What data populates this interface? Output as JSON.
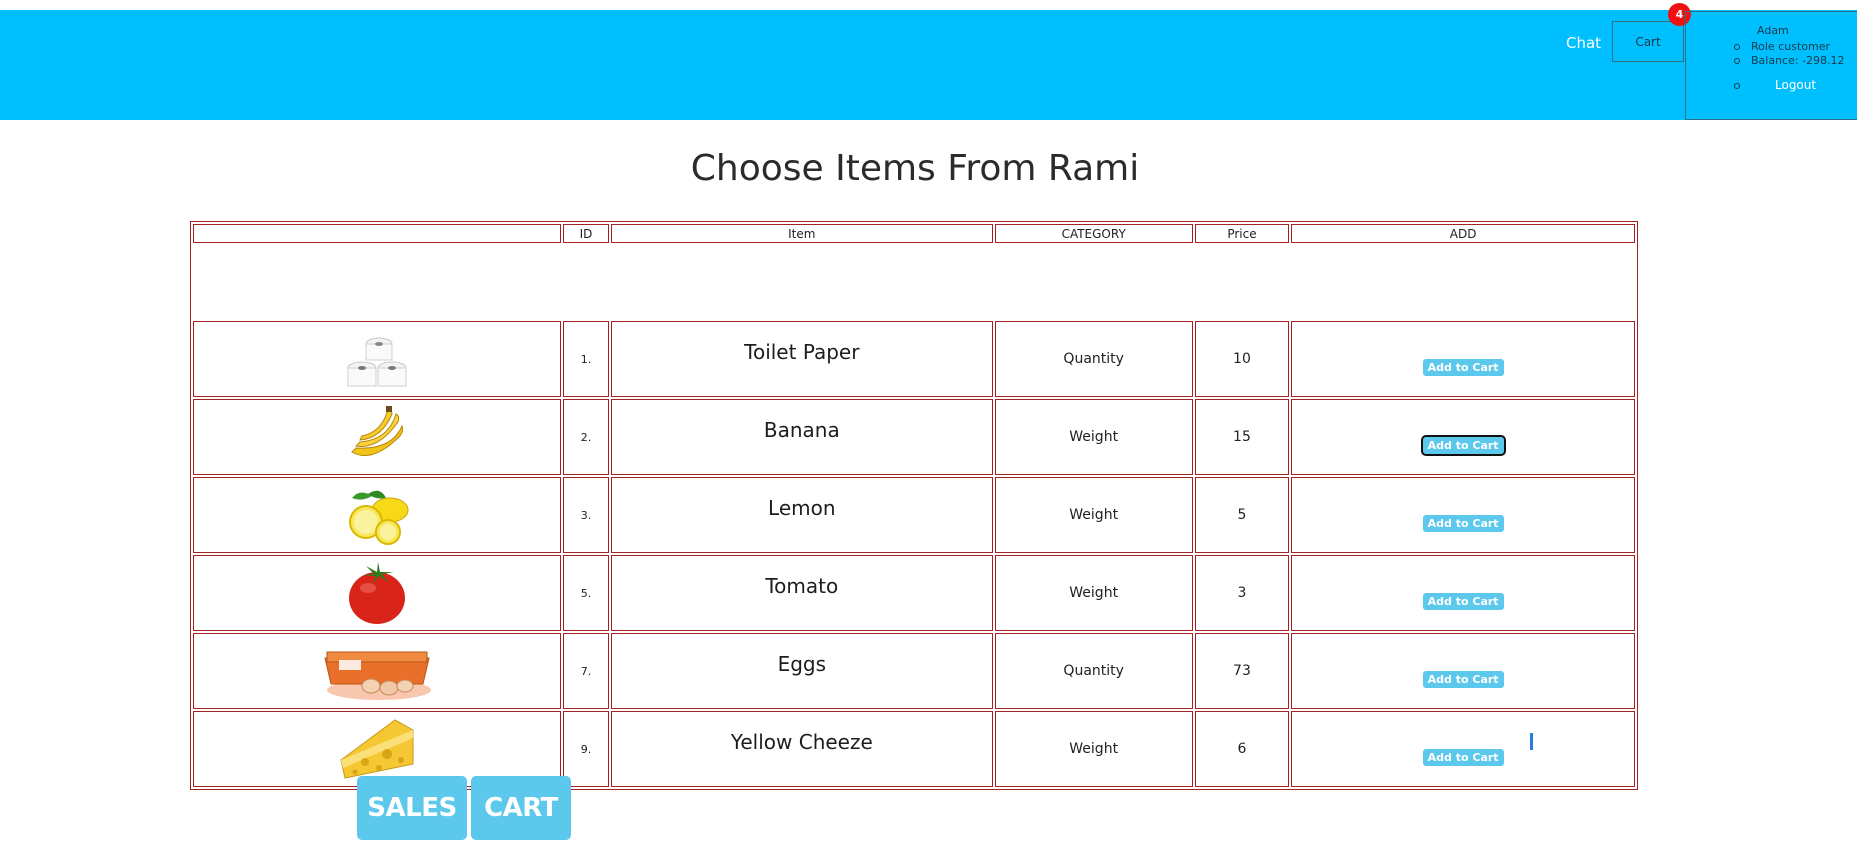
{
  "nav": {
    "chat_label": "Chat",
    "cart_label": "Cart",
    "cart_badge": "4",
    "user": {
      "name": "Adam",
      "role": "Role customer",
      "balance": "Balance: -298.12",
      "logout_label": "Logout"
    },
    "accent_color": "#00bfff"
  },
  "page": {
    "title": "Choose Items From Rami"
  },
  "table": {
    "headers": [
      "",
      "ID",
      "Item",
      "CATEGORY",
      "Price",
      "ADD"
    ],
    "rows": [
      {
        "image_icon": "toilet-paper-icon",
        "id": "1.",
        "item": "Toilet Paper",
        "category": "Quantity",
        "price": "10",
        "add_label": "Add to Cart"
      },
      {
        "image_icon": "banana-icon",
        "id": "2.",
        "item": "Banana",
        "category": "Weight",
        "price": "15",
        "add_label": "Add to Cart"
      },
      {
        "image_icon": "lemon-icon",
        "id": "3.",
        "item": "Lemon",
        "category": "Weight",
        "price": "5",
        "add_label": "Add to Cart"
      },
      {
        "image_icon": "tomato-icon",
        "id": "5.",
        "item": "Tomato",
        "category": "Weight",
        "price": "3",
        "add_label": "Add to Cart"
      },
      {
        "image_icon": "eggs-icon",
        "id": "7.",
        "item": "Eggs",
        "category": "Quantity",
        "price": "73",
        "add_label": "Add to Cart"
      },
      {
        "image_icon": "cheese-icon",
        "id": "9.",
        "item": "Yellow Cheeze",
        "category": "Weight",
        "price": "6",
        "add_label": "Add to Cart"
      }
    ]
  },
  "footer": {
    "sales_label": "SALES",
    "cart_label": "CART",
    "button_color": "#5bc8ec"
  }
}
